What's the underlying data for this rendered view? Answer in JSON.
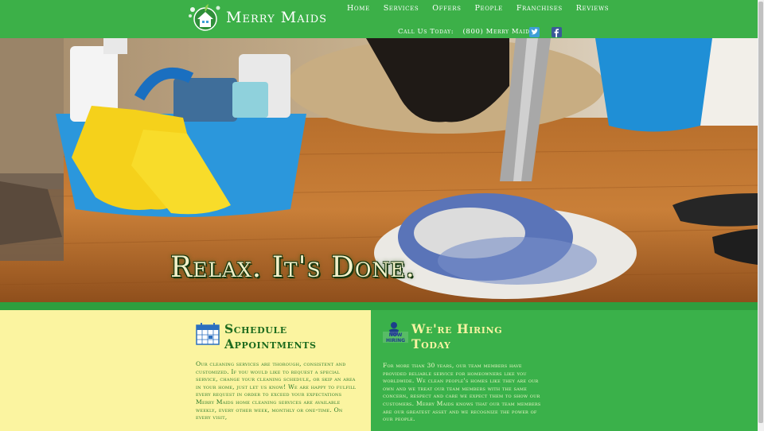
{
  "brand": {
    "name": "Merry Maids",
    "logo_icon": "house-bubbles-logo"
  },
  "nav": {
    "items": [
      "Home",
      "Services",
      "Offers",
      "People",
      "Franchises",
      "Reviews"
    ]
  },
  "contact": {
    "label": "Call Us Today:",
    "phone": "(800) Merry Maids"
  },
  "social": {
    "twitter_icon": "twitter-icon",
    "facebook_icon": "facebook-icon"
  },
  "hero": {
    "tagline": "Relax. It's Done."
  },
  "schedule": {
    "title": "Schedule Appointments",
    "body": "Our cleaning services are thorough, consistent and customized. If you would like to request a special service, change your cleaning schedule, or skip an area in your home, just let us know! We are happy to fulfill every request in order to exceed your expectations Merry Maids home cleaning services are available weekly, every other week, monthly or one-time. On every visit,"
  },
  "hiring": {
    "title": "We're Hiring Today",
    "icon_text": "Now Hiring",
    "body": "For more than 30 years, our team members have provided reliable service for homeowners like you worldwide. We clean people's homes like they are our own and we treat our team members with the same concern, respect and care we expect them to show our customers. Merry Maids knows that our team members are our greatest asset and we recognize the power of our people."
  },
  "colors": {
    "header_green": "#3cb048",
    "panel_yellow": "#fbf4a0",
    "title_green": "#1d6b1e"
  }
}
